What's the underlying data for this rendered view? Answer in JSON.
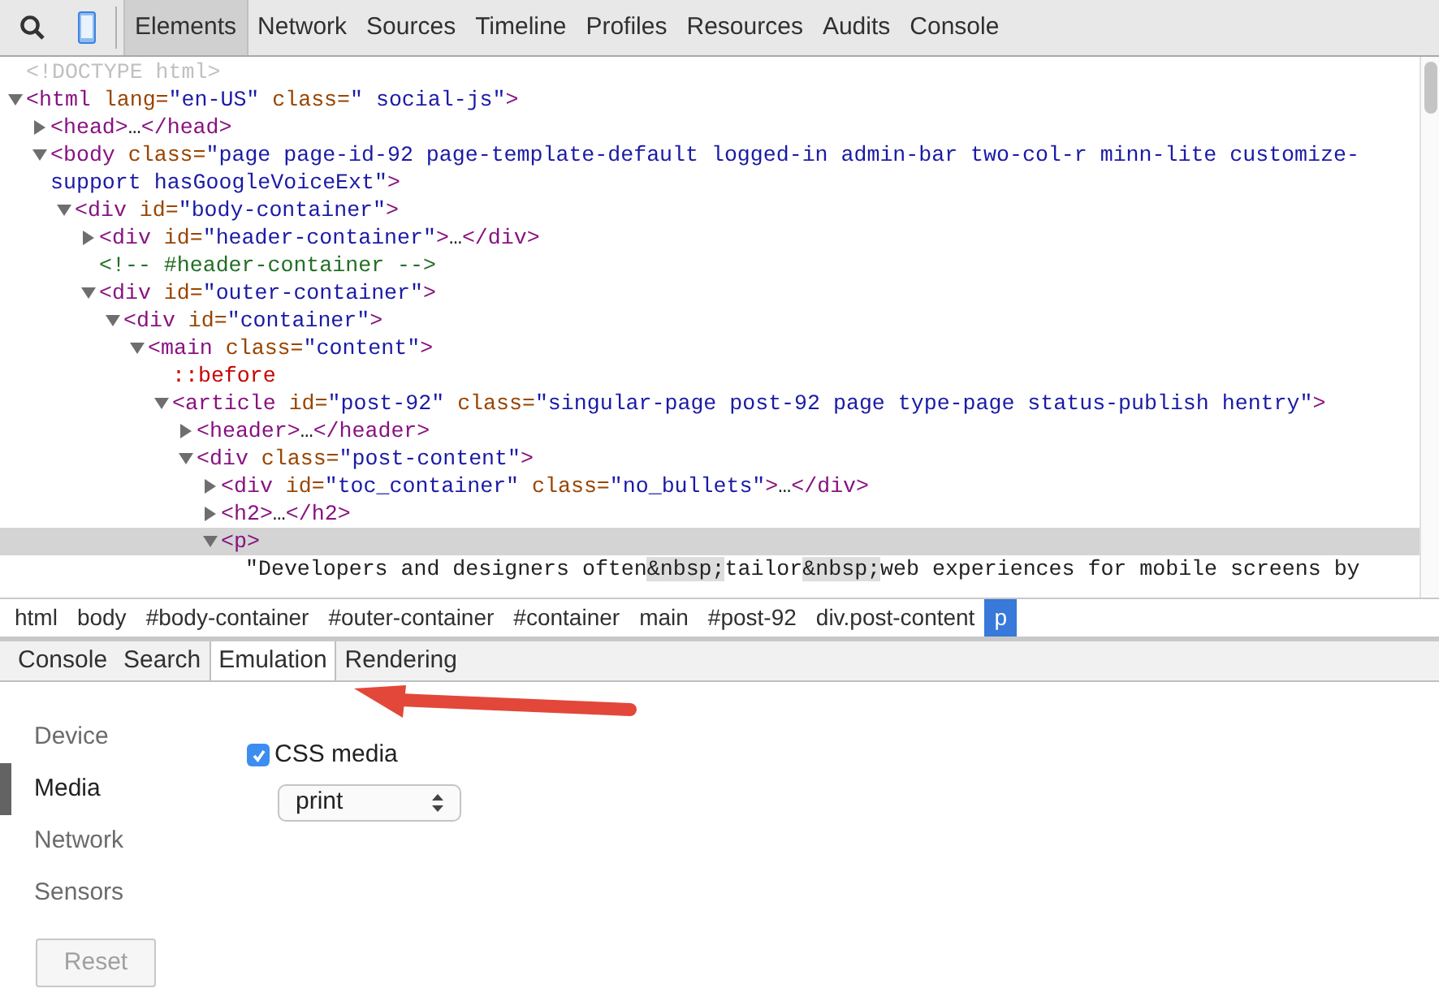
{
  "toolbar": {
    "tabs": [
      {
        "label": "Elements",
        "selected": true
      },
      {
        "label": "Network",
        "selected": false
      },
      {
        "label": "Sources",
        "selected": false
      },
      {
        "label": "Timeline",
        "selected": false
      },
      {
        "label": "Profiles",
        "selected": false
      },
      {
        "label": "Resources",
        "selected": false
      },
      {
        "label": "Audits",
        "selected": false
      },
      {
        "label": "Console",
        "selected": false
      }
    ]
  },
  "dom_tree": [
    {
      "selected": false,
      "tokens": [
        {
          "kind": "doctype",
          "text": "<!DOCTYPE html>"
        }
      ]
    },
    {
      "selected": false,
      "expanded": true,
      "tokens": [
        {
          "kind": "tag",
          "text": "<html"
        },
        {
          "kind": "attr",
          "text": " lang="
        },
        {
          "kind": "value",
          "text": "\"en-US\""
        },
        {
          "kind": "attr",
          "text": " class="
        },
        {
          "kind": "value",
          "text": "\" social-js\""
        },
        {
          "kind": "tag",
          "text": ">"
        }
      ],
      "children": [
        {
          "selected": false,
          "expanded": false,
          "tokens": [
            {
              "kind": "tag",
              "text": "<head>"
            },
            {
              "kind": "text",
              "text": "…"
            },
            {
              "kind": "tag",
              "text": "</head>"
            }
          ]
        },
        {
          "selected": false,
          "expanded": true,
          "tokens": [
            {
              "kind": "tag",
              "text": "<body"
            },
            {
              "kind": "attr",
              "text": " class="
            },
            {
              "kind": "value",
              "text": "\"page page-id-92 page-template-default logged-in admin-bar two-col-r minn-lite customize-support hasGoogleVoiceExt\""
            },
            {
              "kind": "tag",
              "text": ">"
            }
          ],
          "children": [
            {
              "selected": false,
              "expanded": true,
              "tokens": [
                {
                  "kind": "tag",
                  "text": "<div"
                },
                {
                  "kind": "attr",
                  "text": " id="
                },
                {
                  "kind": "value",
                  "text": "\"body-container\""
                },
                {
                  "kind": "tag",
                  "text": ">"
                }
              ],
              "children": [
                {
                  "selected": false,
                  "expanded": false,
                  "tokens": [
                    {
                      "kind": "tag",
                      "text": "<div"
                    },
                    {
                      "kind": "attr",
                      "text": " id="
                    },
                    {
                      "kind": "value",
                      "text": "\"header-container\""
                    },
                    {
                      "kind": "tag",
                      "text": ">"
                    },
                    {
                      "kind": "text",
                      "text": "…"
                    },
                    {
                      "kind": "tag",
                      "text": "</div>"
                    }
                  ]
                },
                {
                  "selected": false,
                  "tokens": [
                    {
                      "kind": "comment",
                      "text": "<!-- #header-container -->"
                    }
                  ]
                },
                {
                  "selected": false,
                  "expanded": true,
                  "tokens": [
                    {
                      "kind": "tag",
                      "text": "<div"
                    },
                    {
                      "kind": "attr",
                      "text": " id="
                    },
                    {
                      "kind": "value",
                      "text": "\"outer-container\""
                    },
                    {
                      "kind": "tag",
                      "text": ">"
                    }
                  ],
                  "children": [
                    {
                      "selected": false,
                      "expanded": true,
                      "tokens": [
                        {
                          "kind": "tag",
                          "text": "<div"
                        },
                        {
                          "kind": "attr",
                          "text": " id="
                        },
                        {
                          "kind": "value",
                          "text": "\"container\""
                        },
                        {
                          "kind": "tag",
                          "text": ">"
                        }
                      ],
                      "children": [
                        {
                          "selected": false,
                          "expanded": true,
                          "tokens": [
                            {
                              "kind": "tag",
                              "text": "<main"
                            },
                            {
                              "kind": "attr",
                              "text": " class="
                            },
                            {
                              "kind": "value",
                              "text": "\"content\""
                            },
                            {
                              "kind": "tag",
                              "text": ">"
                            }
                          ],
                          "children": [
                            {
                              "selected": false,
                              "tokens": [
                                {
                                  "kind": "pseudo",
                                  "text": "::before"
                                }
                              ]
                            },
                            {
                              "selected": false,
                              "expanded": true,
                              "tokens": [
                                {
                                  "kind": "tag",
                                  "text": "<article"
                                },
                                {
                                  "kind": "attr",
                                  "text": " id="
                                },
                                {
                                  "kind": "value",
                                  "text": "\"post-92\""
                                },
                                {
                                  "kind": "attr",
                                  "text": " class="
                                },
                                {
                                  "kind": "value",
                                  "text": "\"singular-page post-92 page type-page status-publish hentry\""
                                },
                                {
                                  "kind": "tag",
                                  "text": ">"
                                }
                              ],
                              "children": [
                                {
                                  "selected": false,
                                  "expanded": false,
                                  "tokens": [
                                    {
                                      "kind": "tag",
                                      "text": "<header>"
                                    },
                                    {
                                      "kind": "text",
                                      "text": "…"
                                    },
                                    {
                                      "kind": "tag",
                                      "text": "</header>"
                                    }
                                  ]
                                },
                                {
                                  "selected": false,
                                  "expanded": true,
                                  "tokens": [
                                    {
                                      "kind": "tag",
                                      "text": "<div"
                                    },
                                    {
                                      "kind": "attr",
                                      "text": " class="
                                    },
                                    {
                                      "kind": "value",
                                      "text": "\"post-content\""
                                    },
                                    {
                                      "kind": "tag",
                                      "text": ">"
                                    }
                                  ],
                                  "children": [
                                    {
                                      "selected": false,
                                      "expanded": false,
                                      "tokens": [
                                        {
                                          "kind": "tag",
                                          "text": "<div"
                                        },
                                        {
                                          "kind": "attr",
                                          "text": " id="
                                        },
                                        {
                                          "kind": "value",
                                          "text": "\"toc_container\""
                                        },
                                        {
                                          "kind": "attr",
                                          "text": " class="
                                        },
                                        {
                                          "kind": "value",
                                          "text": "\"no_bullets\""
                                        },
                                        {
                                          "kind": "tag",
                                          "text": ">"
                                        },
                                        {
                                          "kind": "text",
                                          "text": "…"
                                        },
                                        {
                                          "kind": "tag",
                                          "text": "</div>"
                                        }
                                      ]
                                    },
                                    {
                                      "selected": false,
                                      "expanded": false,
                                      "tokens": [
                                        {
                                          "kind": "tag",
                                          "text": "<h2>"
                                        },
                                        {
                                          "kind": "text",
                                          "text": "…"
                                        },
                                        {
                                          "kind": "tag",
                                          "text": "</h2>"
                                        }
                                      ]
                                    },
                                    {
                                      "selected": true,
                                      "expanded": true,
                                      "tokens": [
                                        {
                                          "kind": "tag",
                                          "text": "<p>"
                                        }
                                      ],
                                      "children": [
                                        {
                                          "selected": false,
                                          "tokens": [
                                            {
                                              "kind": "text",
                                              "text": "\"Developers and designers often"
                                            },
                                            {
                                              "kind": "entity",
                                              "text": "&nbsp;"
                                            },
                                            {
                                              "kind": "text",
                                              "text": "tailor"
                                            },
                                            {
                                              "kind": "entity",
                                              "text": "&nbsp;"
                                            },
                                            {
                                              "kind": "text",
                                              "text": "web experiences for mobile screens by"
                                            }
                                          ]
                                        }
                                      ]
                                    }
                                  ]
                                }
                              ]
                            }
                          ]
                        }
                      ]
                    }
                  ]
                }
              ]
            }
          ]
        }
      ]
    }
  ],
  "breadcrumbs": [
    {
      "label": "html",
      "selected": false
    },
    {
      "label": "body",
      "selected": false
    },
    {
      "label": "#body-container",
      "selected": false
    },
    {
      "label": "#outer-container",
      "selected": false
    },
    {
      "label": "#container",
      "selected": false
    },
    {
      "label": "main",
      "selected": false
    },
    {
      "label": "#post-92",
      "selected": false
    },
    {
      "label": "div.post-content",
      "selected": false
    },
    {
      "label": "p",
      "selected": true
    }
  ],
  "drawer": {
    "tabs": [
      {
        "label": "Console",
        "selected": false
      },
      {
        "label": "Search",
        "selected": false
      },
      {
        "label": "Emulation",
        "selected": true
      },
      {
        "label": "Rendering",
        "selected": false
      }
    ],
    "sidebar": [
      {
        "label": "Device",
        "selected": false
      },
      {
        "label": "Media",
        "selected": true
      },
      {
        "label": "Network",
        "selected": false
      },
      {
        "label": "Sensors",
        "selected": false
      }
    ],
    "reset_button": {
      "label": "Reset",
      "disabled": true
    },
    "css_media": {
      "label": "CSS media",
      "checked": true,
      "value": "print"
    }
  }
}
